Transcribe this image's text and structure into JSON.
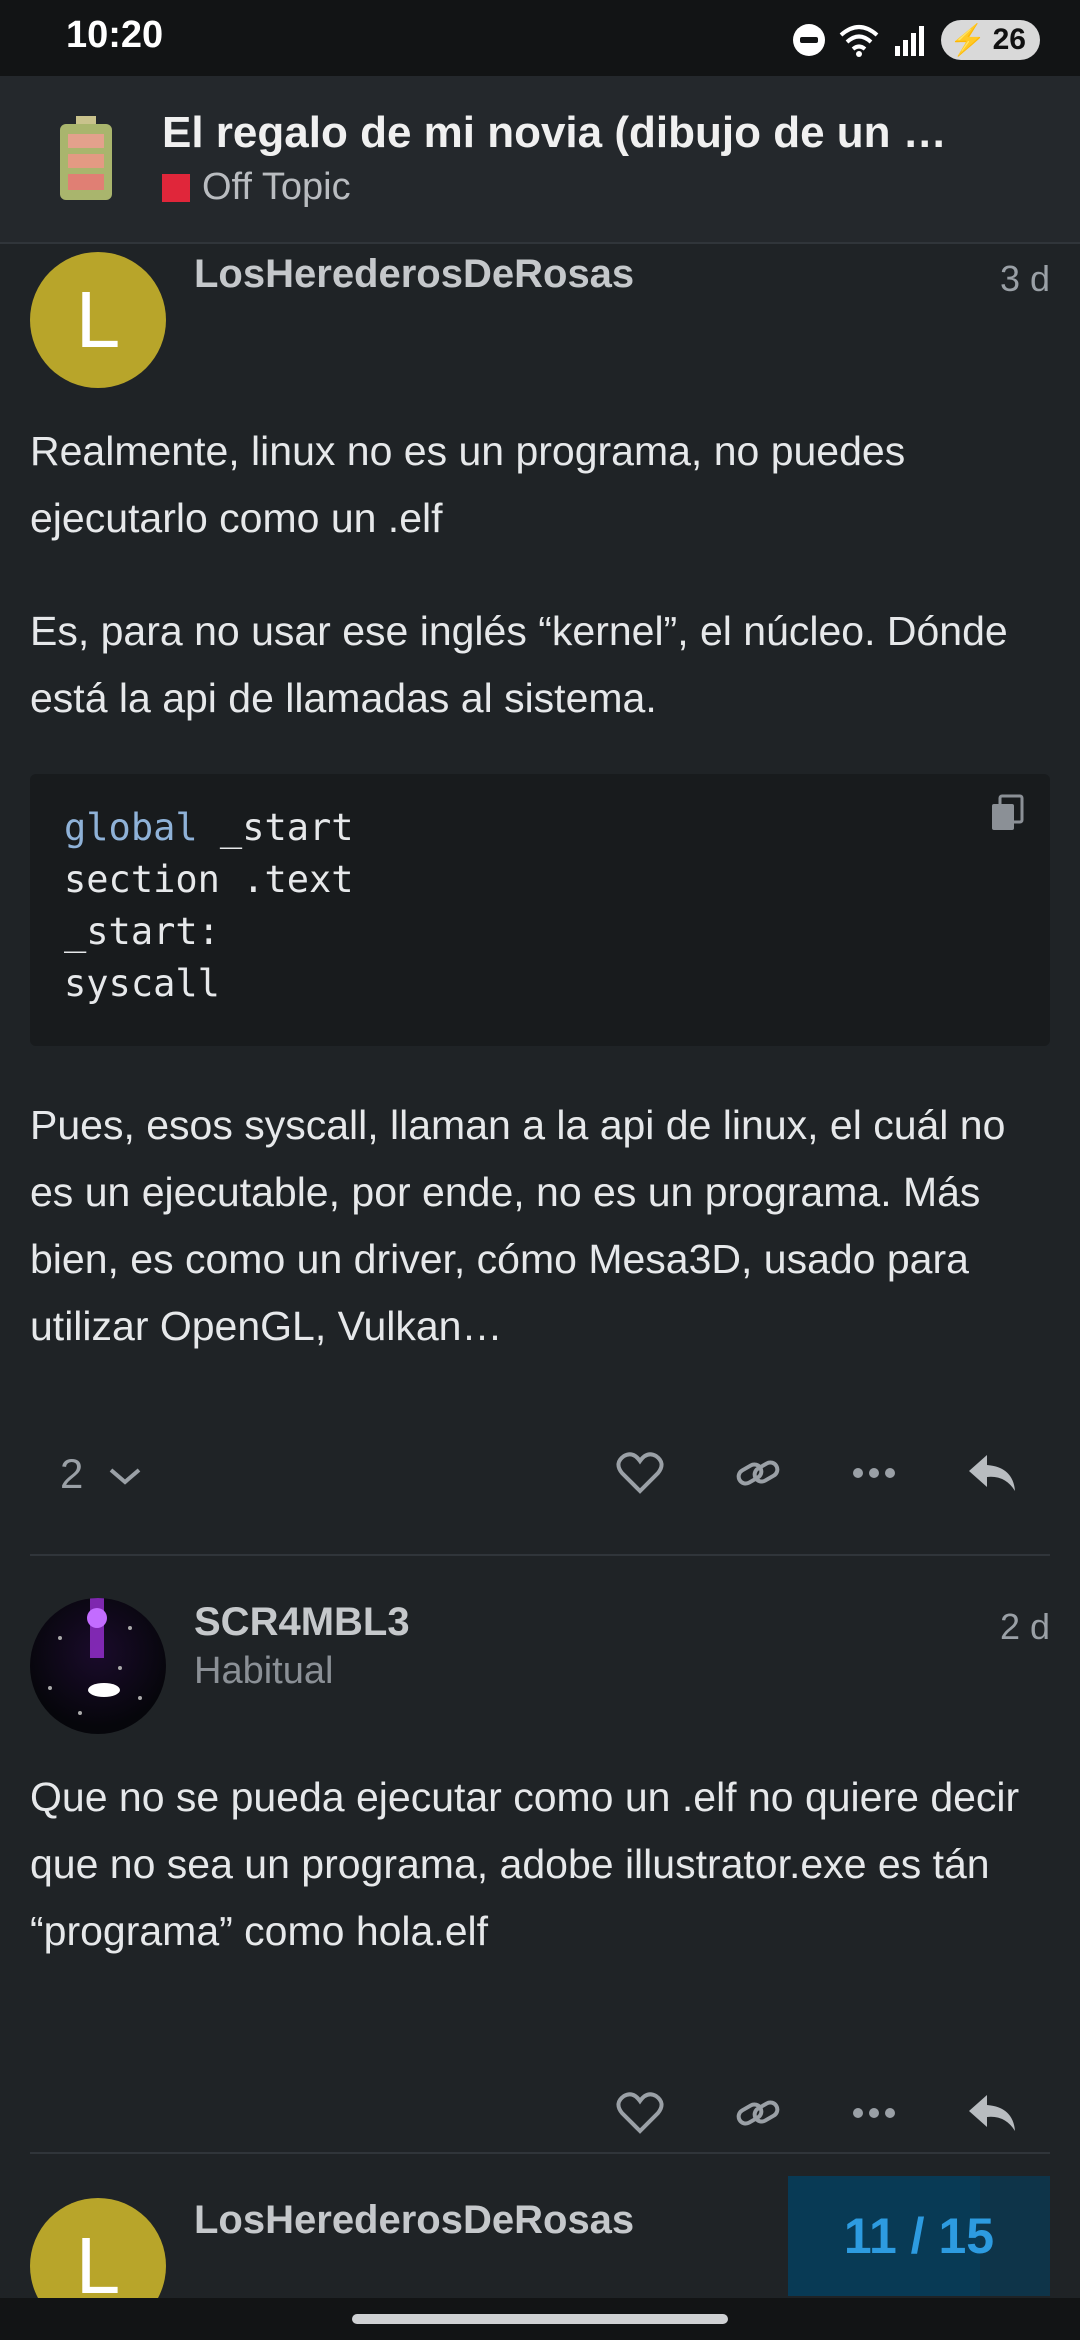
{
  "status_bar": {
    "time": "10:20",
    "battery_level": "26",
    "icons": [
      "do-not-disturb-icon",
      "wifi-icon",
      "signal-icon",
      "battery-icon"
    ]
  },
  "header": {
    "title": "El regalo de mi novia (dibujo de un …",
    "category": "Off Topic",
    "category_color": "#e0263a"
  },
  "posts": [
    {
      "username": "LosHerederosDeRosas",
      "avatar_letter": "L",
      "date": "3 d",
      "paragraphs": [
        "Realmente, linux no es un programa, no puedes ejecutarlo como un .elf",
        "Es, para no usar ese inglés “kernel”, el núcleo. Dónde está la api de llamadas al sistema.",
        "Pues, esos syscall, llaman a la api de linux, el cuál no es un ejecutable, por ende, no es un programa. Más bien, es como un driver, cómo Mesa3D, usado para utilizar OpenGL, Vulkan…"
      ],
      "code": {
        "line1_keyword": "global",
        "line1_rest": " _start",
        "line2": "section .text",
        "line3": "_start:",
        "line4": "syscall"
      },
      "reply_count": "2"
    },
    {
      "username": "SCR4MBL3",
      "user_title": "Habitual",
      "date": "2 d",
      "paragraphs": [
        "Que no se pueda ejecutar como un .elf no quiere decir que no sea un programa, adobe illustrator.exe es tán “programa” como hola.elf"
      ]
    },
    {
      "username": "LosHerederosDeRosas",
      "avatar_letter": "L"
    }
  ],
  "progress": {
    "label": "11 / 15",
    "current": 11,
    "total": 15
  },
  "colors": {
    "background": "#1f2326",
    "accent": "#2d9be0",
    "avatar_yellow": "#b8a52a"
  }
}
